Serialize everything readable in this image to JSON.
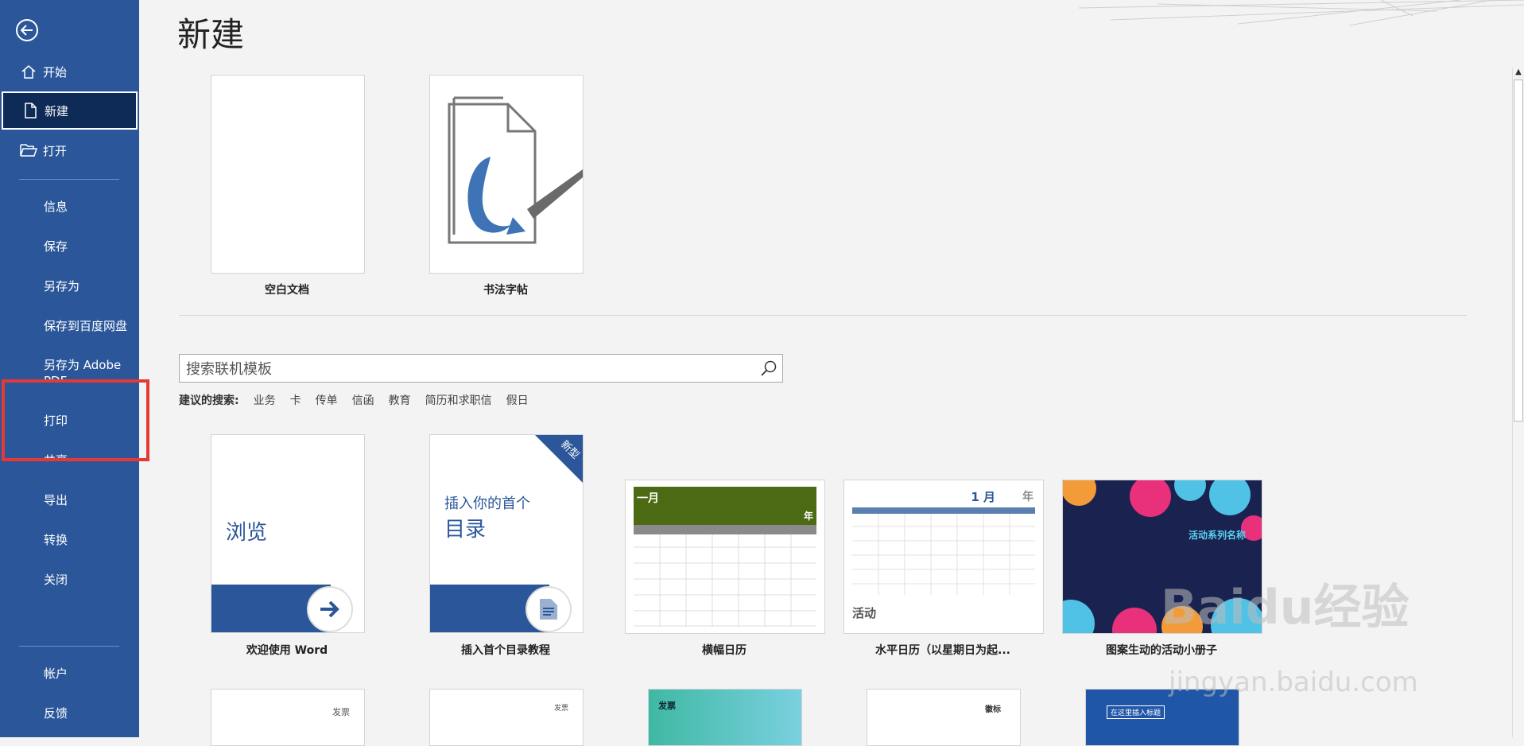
{
  "sidebar": {
    "top_items": [
      {
        "label": "开始",
        "icon": "home-icon"
      },
      {
        "label": "新建",
        "icon": "new-doc-icon"
      },
      {
        "label": "打开",
        "icon": "folder-open-icon"
      }
    ],
    "items": [
      {
        "label": "信息"
      },
      {
        "label": "保存"
      },
      {
        "label": "另存为"
      },
      {
        "label": "保存到百度网盘"
      },
      {
        "label": "另存为 Adobe PDF"
      },
      {
        "label": "打印"
      },
      {
        "label": "共享"
      },
      {
        "label": "导出"
      },
      {
        "label": "转换"
      },
      {
        "label": "关闭"
      }
    ],
    "bottom_items": [
      {
        "label": "帐户"
      },
      {
        "label": "反馈"
      }
    ],
    "bg_color": "#2b579a",
    "active_item": "新建"
  },
  "main": {
    "title": "新建",
    "featured": [
      {
        "label": "空白文档"
      },
      {
        "label": "书法字帖"
      }
    ],
    "search": {
      "placeholder": "搜索联机模板"
    },
    "suggest_header": "建议的搜索:",
    "suggest_links": [
      "业务",
      "卡",
      "传单",
      "信函",
      "教育",
      "简历和求职信",
      "假日"
    ],
    "templates": [
      {
        "label": "欢迎使用 Word",
        "thumb_text": "浏览"
      },
      {
        "label": "插入首个目录教程",
        "thumb_line1": "插入你的首个",
        "thumb_line2": "目录",
        "ribbon": "新型"
      },
      {
        "label": "横幅日历",
        "thumb_month": "一月",
        "thumb_year": "年"
      },
      {
        "label": "水平日历（以星期日为起...",
        "thumb_month": "1 月",
        "thumb_year": "年",
        "thumb_activity": "活动"
      },
      {
        "label": "图案生动的活动小册子",
        "thumb_title": "活动系列名称"
      }
    ],
    "row3_labels": [
      "发票",
      "发票",
      "发票",
      "徽标",
      "在这里插入标题"
    ]
  },
  "watermark": {
    "text": "Baidu经验",
    "sub": "jingyan.baidu.com"
  }
}
